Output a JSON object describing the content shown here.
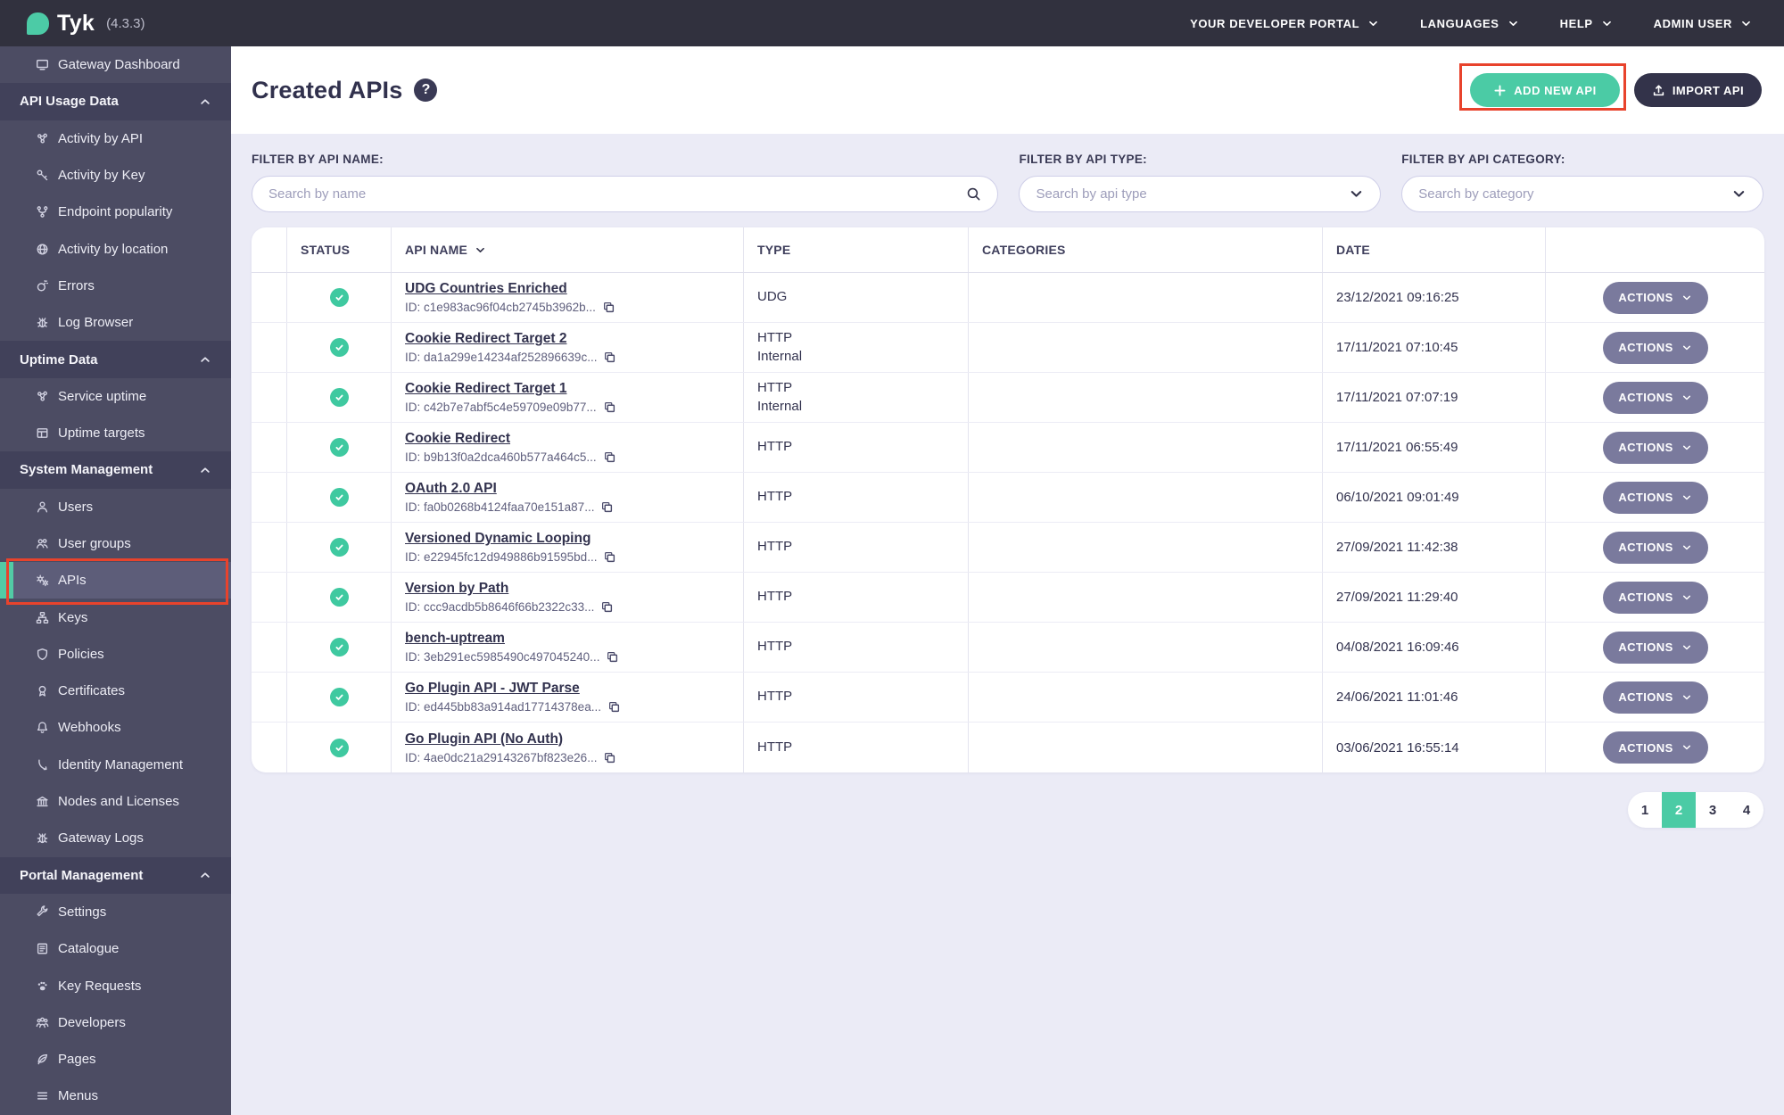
{
  "topbar": {
    "brand": "Tyk",
    "version": "(4.3.3)",
    "menus": [
      "YOUR DEVELOPER PORTAL",
      "LANGUAGES",
      "HELP",
      "ADMIN USER"
    ]
  },
  "sidebar": {
    "items": [
      {
        "type": "link",
        "icon": "monitor",
        "label": "Gateway Dashboard"
      },
      {
        "type": "section",
        "icon": "chevron-up",
        "label": "API Usage Data"
      },
      {
        "type": "link",
        "icon": "molecule",
        "label": "Activity by API"
      },
      {
        "type": "link",
        "icon": "key",
        "label": "Activity by Key"
      },
      {
        "type": "link",
        "icon": "fork",
        "label": "Endpoint popularity"
      },
      {
        "type": "link",
        "icon": "globe",
        "label": "Activity by location"
      },
      {
        "type": "link",
        "icon": "bomb",
        "label": "Errors"
      },
      {
        "type": "link",
        "icon": "bug",
        "label": "Log Browser"
      },
      {
        "type": "section",
        "icon": "chevron-up",
        "label": "Uptime Data"
      },
      {
        "type": "link",
        "icon": "molecule",
        "label": "Service uptime"
      },
      {
        "type": "link",
        "icon": "grid",
        "label": "Uptime targets"
      },
      {
        "type": "section",
        "icon": "chevron-up",
        "label": "System Management"
      },
      {
        "type": "link",
        "icon": "user",
        "label": "Users"
      },
      {
        "type": "link",
        "icon": "user-group",
        "label": "User groups"
      },
      {
        "type": "link",
        "icon": "gears",
        "label": "APIs",
        "active": true
      },
      {
        "type": "link",
        "icon": "sitemap",
        "label": "Keys"
      },
      {
        "type": "link",
        "icon": "shield",
        "label": "Policies"
      },
      {
        "type": "link",
        "icon": "badge",
        "label": "Certificates"
      },
      {
        "type": "link",
        "icon": "bell",
        "label": "Webhooks"
      },
      {
        "type": "link",
        "icon": "hook",
        "label": "Identity Management"
      },
      {
        "type": "link",
        "icon": "bank",
        "label": "Nodes and Licenses"
      },
      {
        "type": "link",
        "icon": "bug",
        "label": "Gateway Logs"
      },
      {
        "type": "section",
        "icon": "chevron-up",
        "label": "Portal Management"
      },
      {
        "type": "link",
        "icon": "wrench",
        "label": "Settings"
      },
      {
        "type": "link",
        "icon": "book",
        "label": "Catalogue"
      },
      {
        "type": "link",
        "icon": "paw",
        "label": "Key Requests"
      },
      {
        "type": "link",
        "icon": "people",
        "label": "Developers"
      },
      {
        "type": "link",
        "icon": "leaf",
        "label": "Pages"
      },
      {
        "type": "link",
        "icon": "menu",
        "label": "Menus"
      }
    ]
  },
  "page": {
    "title": "Created APIs",
    "help_label": "?",
    "add_button": "ADD NEW API",
    "import_button": "IMPORT API"
  },
  "filters": [
    {
      "label": "FILTER BY API NAME:",
      "placeholder": "Search by name",
      "control": "search"
    },
    {
      "label": "FILTER BY API TYPE:",
      "placeholder": "Search by api type",
      "control": "select"
    },
    {
      "label": "FILTER BY API CATEGORY:",
      "placeholder": "Search by category",
      "control": "select"
    }
  ],
  "table": {
    "columns": [
      "",
      "STATUS",
      "API NAME",
      "TYPE",
      "CATEGORIES",
      "DATE",
      ""
    ],
    "actions_label": "ACTIONS",
    "rows": [
      {
        "status": "active",
        "name": "UDG Countries Enriched",
        "id": "ID: c1e983ac96f04cb2745b3962b...",
        "type": [
          "UDG"
        ],
        "categories": "",
        "date": "23/12/2021 09:16:25"
      },
      {
        "status": "active",
        "name": "Cookie Redirect Target 2",
        "id": "ID: da1a299e14234af252896639c...",
        "type": [
          "HTTP",
          "Internal"
        ],
        "categories": "",
        "date": "17/11/2021 07:10:45"
      },
      {
        "status": "active",
        "name": "Cookie Redirect Target 1",
        "id": "ID: c42b7e7abf5c4e59709e09b77...",
        "type": [
          "HTTP",
          "Internal"
        ],
        "categories": "",
        "date": "17/11/2021 07:07:19"
      },
      {
        "status": "active",
        "name": "Cookie Redirect",
        "id": "ID: b9b13f0a2dca460b577a464c5...",
        "type": [
          "HTTP"
        ],
        "categories": "",
        "date": "17/11/2021 06:55:49"
      },
      {
        "status": "active",
        "name": "OAuth 2.0 API",
        "id": "ID: fa0b0268b4124faa70e151a87...",
        "type": [
          "HTTP"
        ],
        "categories": "",
        "date": "06/10/2021 09:01:49"
      },
      {
        "status": "active",
        "name": "Versioned Dynamic Looping",
        "id": "ID: e22945fc12d949886b91595bd...",
        "type": [
          "HTTP"
        ],
        "categories": "",
        "date": "27/09/2021 11:42:38"
      },
      {
        "status": "active",
        "name": "Version by Path",
        "id": "ID: ccc9acdb5b8646f66b2322c33...",
        "type": [
          "HTTP"
        ],
        "categories": "",
        "date": "27/09/2021 11:29:40"
      },
      {
        "status": "active",
        "name": "bench-uptream",
        "id": "ID: 3eb291ec5985490c497045240...",
        "type": [
          "HTTP"
        ],
        "categories": "",
        "date": "04/08/2021 16:09:46"
      },
      {
        "status": "active",
        "name": "Go Plugin API - JWT Parse",
        "id": "ID: ed445bb83a914ad17714378ea...",
        "type": [
          "HTTP"
        ],
        "categories": "",
        "date": "24/06/2021 11:01:46"
      },
      {
        "status": "active",
        "name": "Go Plugin API (No Auth)",
        "id": "ID: 4ae0dc21a29143267bf823e26...",
        "type": [
          "HTTP"
        ],
        "categories": "",
        "date": "03/06/2021 16:55:14"
      }
    ]
  },
  "pagination": {
    "pages": [
      "1",
      "2",
      "3",
      "4"
    ],
    "active": "2"
  },
  "colors": {
    "accent_teal": "#4BCBA5",
    "topbar_bg": "#31313E",
    "sidebar_bg": "#4C4C63",
    "section_bg": "#41415A",
    "dark_navy": "#33334A",
    "annotation_red": "#E8432C",
    "status_green": "#3FC9A0"
  }
}
